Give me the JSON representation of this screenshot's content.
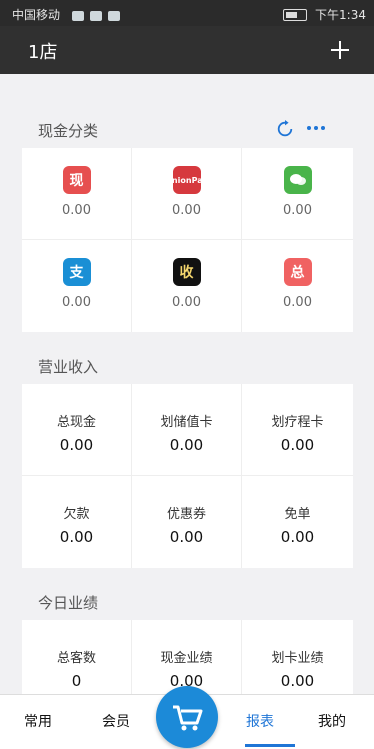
{
  "status_bar": {
    "left_text": "中国移动",
    "right_time": "下午1:34",
    "icons": [
      "signal-icon",
      "wifi-icon",
      "notification-icon",
      "battery-icon"
    ]
  },
  "app_bar": {
    "title": "1店",
    "add_icon": "plus-icon"
  },
  "sections": {
    "cash_category": {
      "title": "现金分类",
      "actions": [
        "refresh-icon",
        "more-icon"
      ],
      "items": [
        {
          "name": "xian",
          "icon_text": "现",
          "color": "#e64f4f",
          "value": "0.00"
        },
        {
          "name": "unionpay",
          "icon_text": "UnionPay",
          "color": "#d6393e",
          "value": "0.00"
        },
        {
          "name": "wechat",
          "icon_text": "",
          "color": "#49b44a",
          "value": "0.00"
        },
        {
          "name": "alipay",
          "icon_text": "支",
          "color": "#1a8fd5",
          "value": "0.00"
        },
        {
          "name": "shou",
          "icon_text": "收",
          "color": "#111111",
          "value": "0.00"
        },
        {
          "name": "zong",
          "icon_text": "总",
          "color": "#f06262",
          "value": "0.00"
        }
      ]
    },
    "revenue": {
      "title": "营业收入",
      "items": [
        {
          "label": "总现金",
          "value": "0.00"
        },
        {
          "label": "划储值卡",
          "value": "0.00"
        },
        {
          "label": "划疗程卡",
          "value": "0.00"
        },
        {
          "label": "欠款",
          "value": "0.00"
        },
        {
          "label": "优惠券",
          "value": "0.00"
        },
        {
          "label": "免单",
          "value": "0.00"
        }
      ]
    },
    "today_performance": {
      "title": "今日业绩",
      "items": [
        {
          "label": "总客数",
          "value": "0"
        },
        {
          "label": "现金业绩",
          "value": "0.00"
        },
        {
          "label": "划卡业绩",
          "value": "0.00"
        }
      ]
    }
  },
  "bottom_nav": {
    "items": [
      "常用",
      "会员",
      "报表",
      "我的"
    ],
    "active": "报表",
    "fab_icon": "cart-icon"
  },
  "colors": {
    "appbar": "#303030",
    "accent": "#1f75d6",
    "fab": "#1c8ad8"
  }
}
